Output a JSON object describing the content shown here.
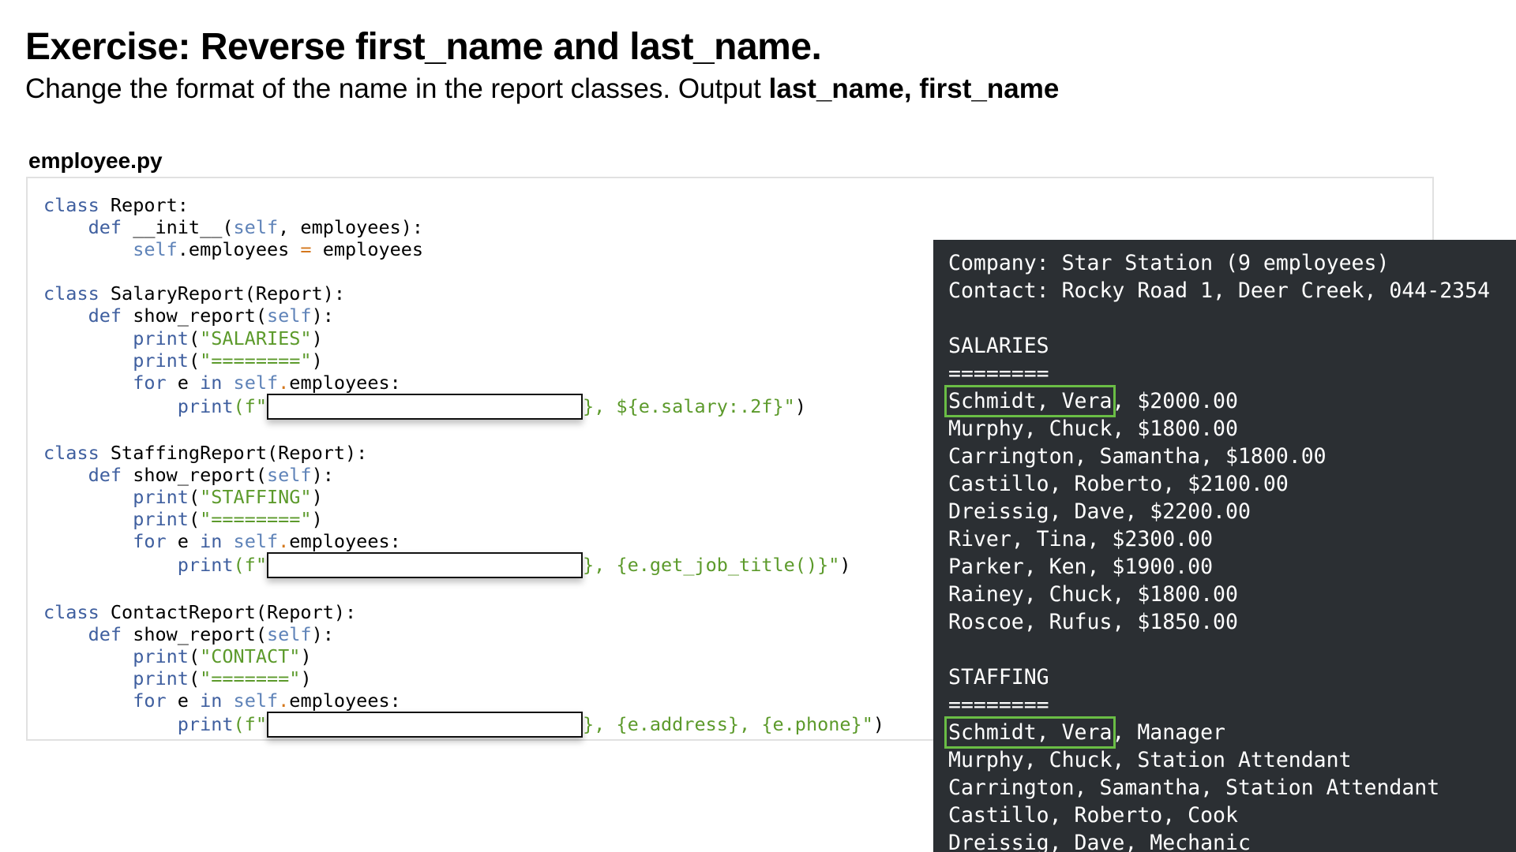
{
  "heading": {
    "title": "Exercise: Reverse first_name and last_name.",
    "subtitle_plain": "Change the format of the name in the report classes. Output ",
    "subtitle_bold": "last_name, first_name"
  },
  "file": {
    "name": "employee.py"
  },
  "code": {
    "kw_class": "class",
    "kw_def": "def",
    "kw_for": "for",
    "kw_in": "in",
    "self": "self",
    "print": "print",
    "report_class": " Report:",
    "init_def": " __init__(",
    "init_args": ", employees):",
    "assign_attr": ".employees ",
    "assign_op": "=",
    "assign_val": " employees",
    "salary_class": " SalaryReport(Report):",
    "staffing_class": " StaffingReport(Report):",
    "contact_class": " ContactReport(Report):",
    "show_def": " show_report(",
    "show_close": "):",
    "salaries_str": "\"SALARIES\"",
    "salaries_sep": "\"========\"",
    "staffing_str": "\"STAFFING\"",
    "staffing_sep": "\"========\"",
    "contact_str": "\"CONTACT\"",
    "contact_sep": "\"=======\"",
    "loop_var": " e ",
    "loop_attr": "employees:",
    "fstring_open": "(f\"",
    "salary_tail": "}, ${e.salary:.2f}\"",
    "staffing_tail": "}, {e.get_job_title()}\"",
    "contact_tail": "}, {e.address}, {e.phone}\""
  },
  "terminal": {
    "company": "Company: Star Station (9 employees)",
    "contact": "Contact: Rocky Road 1, Deer Creek, 044-2354",
    "salaries_header": "SALARIES",
    "salaries_sep": "========",
    "salaries_first_name": "Schmidt, Vera",
    "salaries_first_rest": ", $2000.00",
    "salaries_rows": [
      "Murphy, Chuck, $1800.00",
      "Carrington, Samantha, $1800.00",
      "Castillo, Roberto, $2100.00",
      "Dreissig, Dave, $2200.00",
      "River, Tina, $2300.00",
      "Parker, Ken, $1900.00",
      "Rainey, Chuck, $1800.00",
      "Roscoe, Rufus, $1850.00"
    ],
    "staffing_header": "STAFFING",
    "staffing_sep": "========",
    "staffing_first_name": "Schmidt, Vera",
    "staffing_first_rest": ", Manager",
    "staffing_rows": [
      "Murphy, Chuck, Station Attendant",
      "Carrington, Samantha, Station Attendant",
      "Castillo, Roberto, Cook",
      "Dreissig, Dave, Mechanic"
    ]
  },
  "colors": {
    "keyword": "#3f5f9f",
    "string": "#5c9a2b",
    "terminal_bg": "#2b2f33",
    "highlight": "#6abd45"
  }
}
